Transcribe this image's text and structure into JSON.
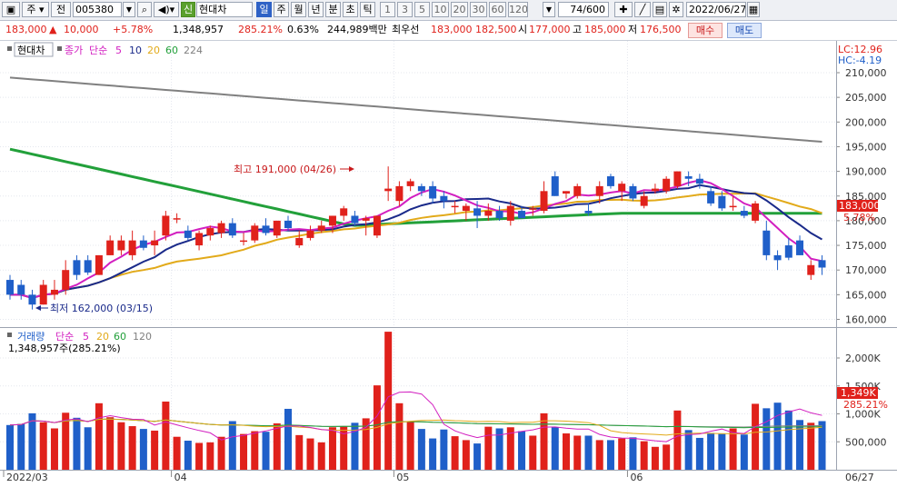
{
  "toolbar": {
    "market_sel": "주",
    "prev_btn": "전",
    "code": "005380",
    "badge": "신",
    "name": "현대차",
    "periods": [
      "일",
      "주",
      "월",
      "년",
      "분",
      "초",
      "틱"
    ],
    "numbers": [
      "1",
      "3",
      "5",
      "10",
      "20",
      "30",
      "60",
      "120"
    ],
    "count": "74/600",
    "date": "2022/06/27"
  },
  "info": {
    "price": "183,000",
    "change": "10,000",
    "change_pct": "+5.78%",
    "volume": "1,348,957",
    "volume_pct": "285.21%",
    "turnover": "0.63%",
    "amount": "244,989백만",
    "ask_label": "최우선",
    "ask": "183,000",
    "bid": "182,500",
    "open_label": "시",
    "open": "177,000",
    "high_label": "고",
    "high": "185,000",
    "low_label": "저",
    "low": "176,500",
    "buy": "매수",
    "sell": "매도"
  },
  "chart_legend": {
    "name": "현대차",
    "close": "종가",
    "simple": "단순",
    "ma5": "5",
    "ma10": "10",
    "ma20": "20",
    "ma60": "60",
    "ma224": "224",
    "lc": "LC:12.96",
    "hc": "HC:-4.19",
    "current_price": "183,000",
    "current_pct": "5.78%"
  },
  "volume_legend": {
    "title": "거래량",
    "simple": "단순",
    "ma5": "5",
    "ma20": "20",
    "ma60": "60",
    "ma120": "120",
    "value": "1,348,957주(285.21%)",
    "current": "1,349K",
    "current_pct": "285.21%"
  },
  "annotations": {
    "high": "최고 191,000 (04/26)",
    "low": "최저 162,000 (03/15)"
  },
  "colors": {
    "up": "#e0211b",
    "down": "#1f5fc9",
    "ma5": "#d21fc0",
    "ma10": "#1a2a8a",
    "ma20": "#e2aa1a",
    "ma60": "#22a03a",
    "ma224": "#808080"
  },
  "chart_data": {
    "type": "candlestick",
    "y_axis": {
      "min": 160000,
      "max": 210000,
      "ticks": [
        "160,000",
        "165,000",
        "170,000",
        "175,000",
        "180,000",
        "185,000",
        "190,000",
        "195,000",
        "200,000",
        "205,000",
        "210,000"
      ]
    },
    "volume_axis": {
      "max": 2500,
      "unit": "K",
      "ticks": [
        "500,000",
        "1,000K",
        "1,500K",
        "2,000K"
      ]
    },
    "x_labels": [
      "2022/03",
      "04",
      "05",
      "06",
      "06/27"
    ],
    "candles": [
      {
        "o": 168000,
        "h": 169000,
        "l": 164000,
        "c": 165000,
        "v": 800
      },
      {
        "o": 167000,
        "h": 168000,
        "l": 164000,
        "c": 165000,
        "v": 820
      },
      {
        "o": 165000,
        "h": 166000,
        "l": 162000,
        "c": 163000,
        "v": 1010
      },
      {
        "o": 163000,
        "h": 168000,
        "l": 163000,
        "c": 167000,
        "v": 850
      },
      {
        "o": 165000,
        "h": 168000,
        "l": 164000,
        "c": 166000,
        "v": 740
      },
      {
        "o": 166000,
        "h": 172000,
        "l": 165000,
        "c": 170000,
        "v": 1020
      },
      {
        "o": 172000,
        "h": 173000,
        "l": 168000,
        "c": 169000,
        "v": 930
      },
      {
        "o": 172000,
        "h": 173000,
        "l": 169000,
        "c": 169500,
        "v": 760
      },
      {
        "o": 169000,
        "h": 173000,
        "l": 169000,
        "c": 173000,
        "v": 1190
      },
      {
        "o": 173000,
        "h": 177000,
        "l": 173000,
        "c": 176000,
        "v": 940
      },
      {
        "o": 174000,
        "h": 177000,
        "l": 173000,
        "c": 176000,
        "v": 850
      },
      {
        "o": 173000,
        "h": 178000,
        "l": 172000,
        "c": 176000,
        "v": 780
      },
      {
        "o": 176000,
        "h": 177000,
        "l": 174000,
        "c": 174500,
        "v": 730
      },
      {
        "o": 175000,
        "h": 178000,
        "l": 173000,
        "c": 176000,
        "v": 700
      },
      {
        "o": 177000,
        "h": 182000,
        "l": 176000,
        "c": 181000,
        "v": 1220
      },
      {
        "o": 180500,
        "h": 181500,
        "l": 179500,
        "c": 180500,
        "v": 590
      },
      {
        "o": 178000,
        "h": 179000,
        "l": 176000,
        "c": 176500,
        "v": 520
      },
      {
        "o": 175000,
        "h": 178000,
        "l": 174000,
        "c": 177500,
        "v": 480
      },
      {
        "o": 177000,
        "h": 179000,
        "l": 176000,
        "c": 178500,
        "v": 490
      },
      {
        "o": 177500,
        "h": 180000,
        "l": 176500,
        "c": 179500,
        "v": 590
      },
      {
        "o": 179500,
        "h": 180500,
        "l": 176500,
        "c": 177000,
        "v": 870
      },
      {
        "o": 176000,
        "h": 177500,
        "l": 175000,
        "c": 176000,
        "v": 640
      },
      {
        "o": 176000,
        "h": 179500,
        "l": 175500,
        "c": 179000,
        "v": 690
      },
      {
        "o": 179000,
        "h": 180500,
        "l": 177000,
        "c": 177500,
        "v": 680
      },
      {
        "o": 177000,
        "h": 180000,
        "l": 176500,
        "c": 180000,
        "v": 830
      },
      {
        "o": 180000,
        "h": 181000,
        "l": 178000,
        "c": 178500,
        "v": 1090
      },
      {
        "o": 175000,
        "h": 178000,
        "l": 174500,
        "c": 176500,
        "v": 620
      },
      {
        "o": 176500,
        "h": 179000,
        "l": 176000,
        "c": 178000,
        "v": 560
      },
      {
        "o": 178000,
        "h": 180000,
        "l": 177500,
        "c": 179000,
        "v": 490
      },
      {
        "o": 179000,
        "h": 181000,
        "l": 177500,
        "c": 181000,
        "v": 760
      },
      {
        "o": 181000,
        "h": 183000,
        "l": 180000,
        "c": 182500,
        "v": 780
      },
      {
        "o": 181000,
        "h": 182000,
        "l": 179000,
        "c": 179500,
        "v": 840
      },
      {
        "o": 180000,
        "h": 181000,
        "l": 177000,
        "c": 180500,
        "v": 920
      },
      {
        "o": 177000,
        "h": 181000,
        "l": 176500,
        "c": 181000,
        "v": 1510
      },
      {
        "o": 186000,
        "h": 191000,
        "l": 184000,
        "c": 186500,
        "v": 2470
      },
      {
        "o": 184000,
        "h": 188000,
        "l": 183000,
        "c": 187000,
        "v": 1190
      },
      {
        "o": 187000,
        "h": 188500,
        "l": 186000,
        "c": 188000,
        "v": 870
      },
      {
        "o": 187000,
        "h": 187500,
        "l": 185000,
        "c": 186000,
        "v": 730
      },
      {
        "o": 187000,
        "h": 188000,
        "l": 183500,
        "c": 184500,
        "v": 560
      },
      {
        "o": 185000,
        "h": 186000,
        "l": 182500,
        "c": 184000,
        "v": 720
      },
      {
        "o": 183000,
        "h": 184000,
        "l": 181500,
        "c": 183000,
        "v": 600
      },
      {
        "o": 182000,
        "h": 183500,
        "l": 180000,
        "c": 183000,
        "v": 530
      },
      {
        "o": 182500,
        "h": 184000,
        "l": 178500,
        "c": 181000,
        "v": 470
      },
      {
        "o": 181000,
        "h": 183500,
        "l": 180000,
        "c": 182000,
        "v": 770
      },
      {
        "o": 182000,
        "h": 183000,
        "l": 180000,
        "c": 180500,
        "v": 740
      },
      {
        "o": 180000,
        "h": 184000,
        "l": 179000,
        "c": 183000,
        "v": 760
      },
      {
        "o": 182000,
        "h": 183000,
        "l": 180500,
        "c": 180500,
        "v": 690
      },
      {
        "o": 182500,
        "h": 183000,
        "l": 181000,
        "c": 182500,
        "v": 610
      },
      {
        "o": 182000,
        "h": 188000,
        "l": 181500,
        "c": 186000,
        "v": 1010
      },
      {
        "o": 189000,
        "h": 190000,
        "l": 185000,
        "c": 185000,
        "v": 760
      },
      {
        "o": 185500,
        "h": 186000,
        "l": 184500,
        "c": 186000,
        "v": 650
      },
      {
        "o": 185000,
        "h": 187500,
        "l": 184500,
        "c": 187000,
        "v": 610
      },
      {
        "o": 182000,
        "h": 183500,
        "l": 181000,
        "c": 181500,
        "v": 610
      },
      {
        "o": 185000,
        "h": 188000,
        "l": 183500,
        "c": 187000,
        "v": 530
      },
      {
        "o": 189000,
        "h": 189500,
        "l": 186500,
        "c": 187000,
        "v": 530
      },
      {
        "o": 186000,
        "h": 188000,
        "l": 184000,
        "c": 187500,
        "v": 560
      },
      {
        "o": 187000,
        "h": 187500,
        "l": 184000,
        "c": 184500,
        "v": 580
      },
      {
        "o": 183000,
        "h": 186000,
        "l": 182500,
        "c": 185000,
        "v": 510
      },
      {
        "o": 186000,
        "h": 187500,
        "l": 185500,
        "c": 186500,
        "v": 410
      },
      {
        "o": 186000,
        "h": 189000,
        "l": 185500,
        "c": 188500,
        "v": 450
      },
      {
        "o": 187000,
        "h": 190000,
        "l": 186500,
        "c": 190000,
        "v": 1060
      },
      {
        "o": 189000,
        "h": 190000,
        "l": 187000,
        "c": 188500,
        "v": 710
      },
      {
        "o": 188500,
        "h": 189500,
        "l": 186500,
        "c": 187500,
        "v": 570
      },
      {
        "o": 186000,
        "h": 187000,
        "l": 183000,
        "c": 183500,
        "v": 660
      },
      {
        "o": 185000,
        "h": 186000,
        "l": 182000,
        "c": 182500,
        "v": 640
      },
      {
        "o": 183000,
        "h": 185000,
        "l": 182000,
        "c": 183000,
        "v": 740
      },
      {
        "o": 182000,
        "h": 183000,
        "l": 180500,
        "c": 181000,
        "v": 630
      },
      {
        "o": 180000,
        "h": 184000,
        "l": 179500,
        "c": 183500,
        "v": 1180
      },
      {
        "o": 178000,
        "h": 180000,
        "l": 172000,
        "c": 173000,
        "v": 1100
      },
      {
        "o": 173000,
        "h": 174000,
        "l": 170000,
        "c": 172000,
        "v": 1200
      },
      {
        "o": 175000,
        "h": 176500,
        "l": 172000,
        "c": 172500,
        "v": 1060
      },
      {
        "o": 176000,
        "h": 177000,
        "l": 173000,
        "c": 173000,
        "v": 890
      },
      {
        "o": 169000,
        "h": 172000,
        "l": 168000,
        "c": 171000,
        "v": 840
      },
      {
        "o": 172000,
        "h": 173000,
        "l": 169000,
        "c": 170500,
        "v": 870
      }
    ]
  }
}
